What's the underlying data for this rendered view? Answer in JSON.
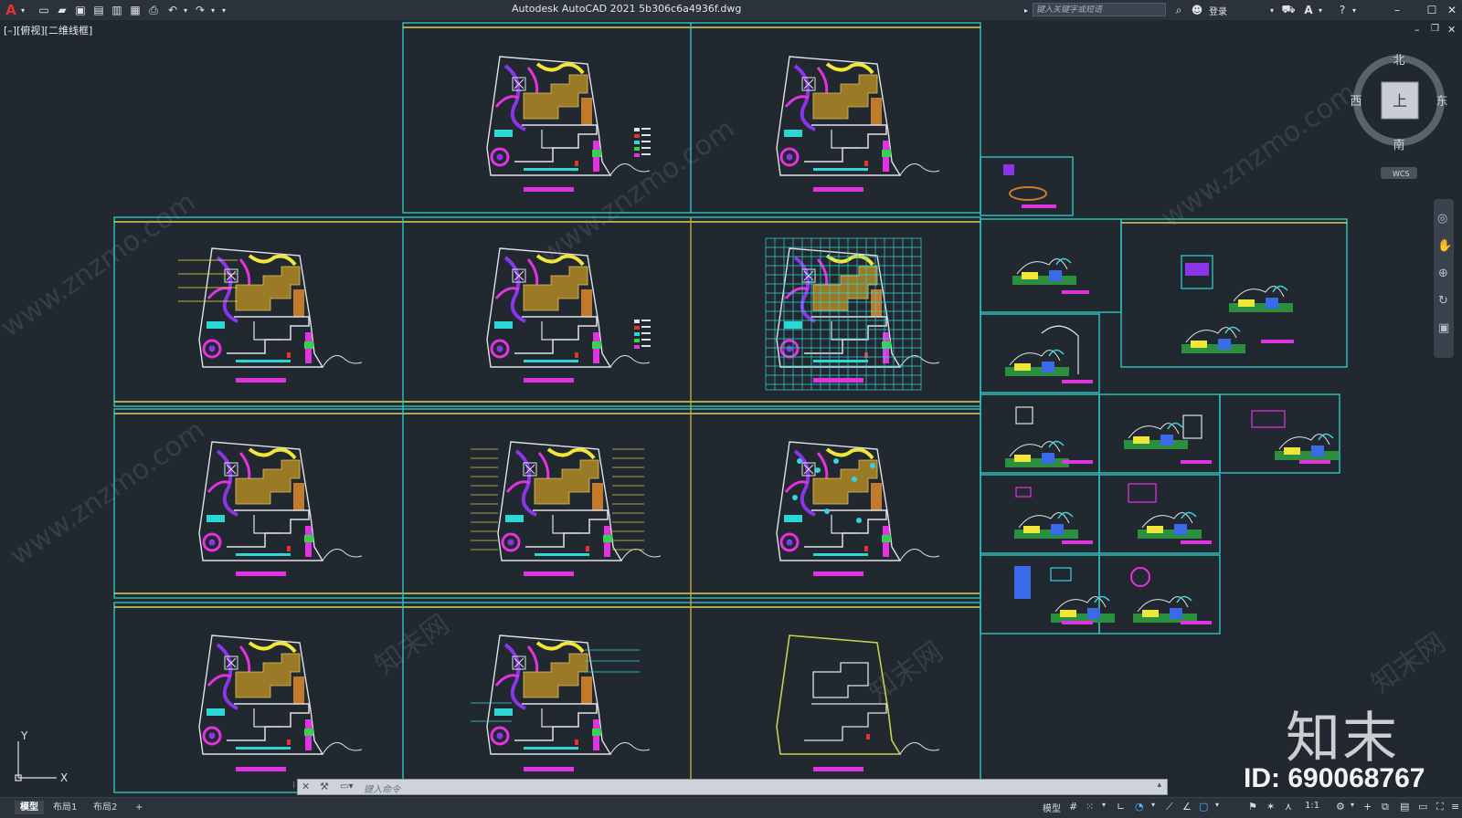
{
  "app": {
    "logo_letter": "A",
    "title": "Autodesk AutoCAD 2021    5b306c6a4936f.dwg",
    "search_placeholder": "键入关键字或短语",
    "login_label": "登录"
  },
  "viewport": {
    "view_label": "[–][俯视][二维线框]"
  },
  "viewcube": {
    "north": "北",
    "south": "南",
    "east": "东",
    "west": "西",
    "top_face": "上",
    "wcs_label": "WCS"
  },
  "ucs": {
    "y_label": "Y",
    "x_label": "X"
  },
  "command": {
    "placeholder": "键入命令"
  },
  "layout_tabs": [
    "模型",
    "布局1",
    "布局2"
  ],
  "status": {
    "model_label": "模型",
    "scale": "1:1"
  },
  "watermark": {
    "brand": "知末",
    "id": "ID: 690068767",
    "site": "www.znzmo.com",
    "cn": "知末网"
  },
  "colors": {
    "background": "#212830",
    "frame_cyan": "#2fc4c4",
    "frame_yellow": "#d6d65a",
    "magenta": "#e233e0",
    "accent_red": "#e0362c"
  }
}
